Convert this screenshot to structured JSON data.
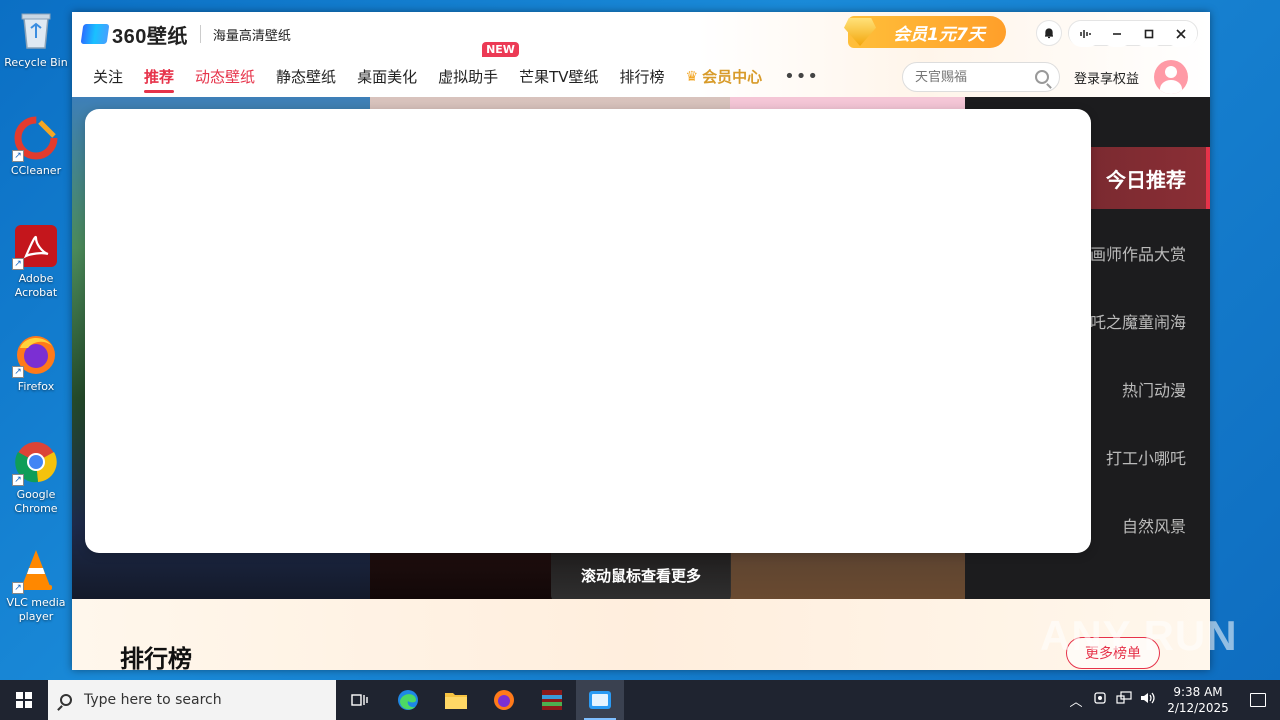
{
  "desktop": {
    "icons": [
      {
        "label": "Recycle Bin",
        "icon": "recycle-bin-icon"
      },
      {
        "label": "CCleaner",
        "icon": "ccleaner-icon"
      },
      {
        "label": "Adobe Acrobat",
        "icon": "adobe-acrobat-icon"
      },
      {
        "label": "Firefox",
        "icon": "firefox-icon"
      },
      {
        "label": "Google Chrome",
        "icon": "chrome-icon"
      },
      {
        "label": "VLC media player",
        "icon": "vlc-icon"
      }
    ]
  },
  "app": {
    "logo_text": "360壁纸",
    "slogan": "海量高清壁纸",
    "promo": "会员1元7天",
    "nav": [
      {
        "label": "关注"
      },
      {
        "label": "推荐",
        "active": true
      },
      {
        "label": "动态壁纸"
      },
      {
        "label": "静态壁纸"
      },
      {
        "label": "桌面美化"
      },
      {
        "label": "虚拟助手",
        "badge": "NEW"
      },
      {
        "label": "芒果TV壁纸"
      },
      {
        "label": "排行榜"
      },
      {
        "label": "会员中心"
      }
    ],
    "more": "•••",
    "search": {
      "placeholder": "天官赐福"
    },
    "login": "登录享权益",
    "side_menu": {
      "active": "今日推荐",
      "items": [
        "画师作品大赏",
        "吒之魔童闹海",
        "热门动漫",
        "打工小哪吒",
        "自然风景"
      ]
    },
    "scroll_hint": "滚动鼠标查看更多",
    "ranking": {
      "title": "排行榜",
      "more": "更多榜单"
    },
    "accent_color": "#e6334a"
  },
  "watermark": "ANY RUN",
  "taskbar": {
    "search_placeholder": "Type here to search",
    "time": "9:38 AM",
    "date": "2/12/2025"
  }
}
